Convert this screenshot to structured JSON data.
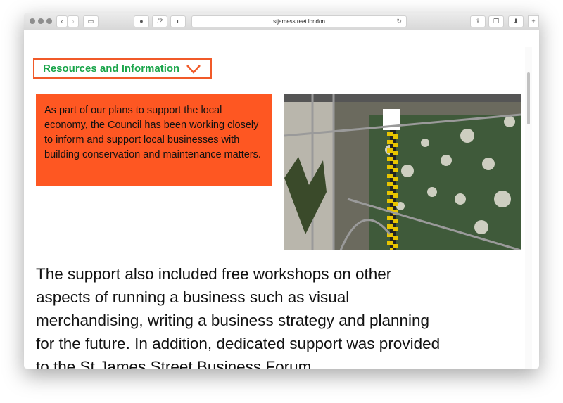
{
  "browser": {
    "url": "stjamesstreet.london"
  },
  "menu": {
    "label": "Resources and Information",
    "accent": "#1aa54a",
    "border": "#f15a29"
  },
  "callout": {
    "text": "As part of our plans to support the local economy, the Council has been working closely to inform and support local businesses with building conservation and maintenance matters.",
    "background": "#fe5722"
  },
  "body": {
    "text": "The support also included free workshops on other aspects of running a business such as visual merchandising, writing a business strategy and planning for the future. In addition, dedicated support was provided to the St James Street Business Forum."
  }
}
